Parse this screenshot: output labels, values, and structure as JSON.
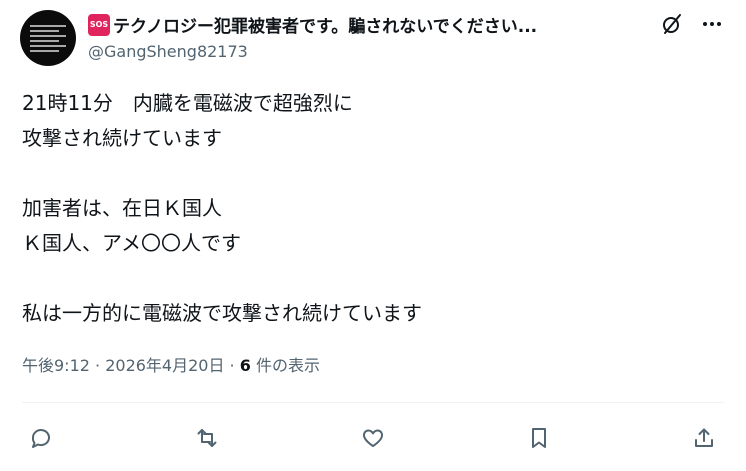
{
  "author": {
    "badge": "SOS",
    "display_name": "テクノロジー犯罪被害者です。騙されないでください...",
    "handle": "@GangSheng82173"
  },
  "tweet": {
    "text": "21時11分　内臓を電磁波で超強烈に\n攻撃され続けています\n\n加害者は、在日Ｋ国人\nＫ国人、アメ〇〇人です\n\n私は一方的に電磁波で攻撃され続けています"
  },
  "meta": {
    "time": "午後9:12",
    "sep": " · ",
    "date": "2026年4月20日",
    "view_count": "6",
    "view_label": " 件の表示"
  },
  "icons": {
    "header": [
      "grok-icon",
      "more-icon"
    ],
    "actions": [
      "reply-icon",
      "retweet-icon",
      "like-icon",
      "bookmark-icon",
      "share-icon"
    ]
  },
  "colors": {
    "text": "#0f1419",
    "secondary": "#536471",
    "badge": "#e0245e"
  }
}
